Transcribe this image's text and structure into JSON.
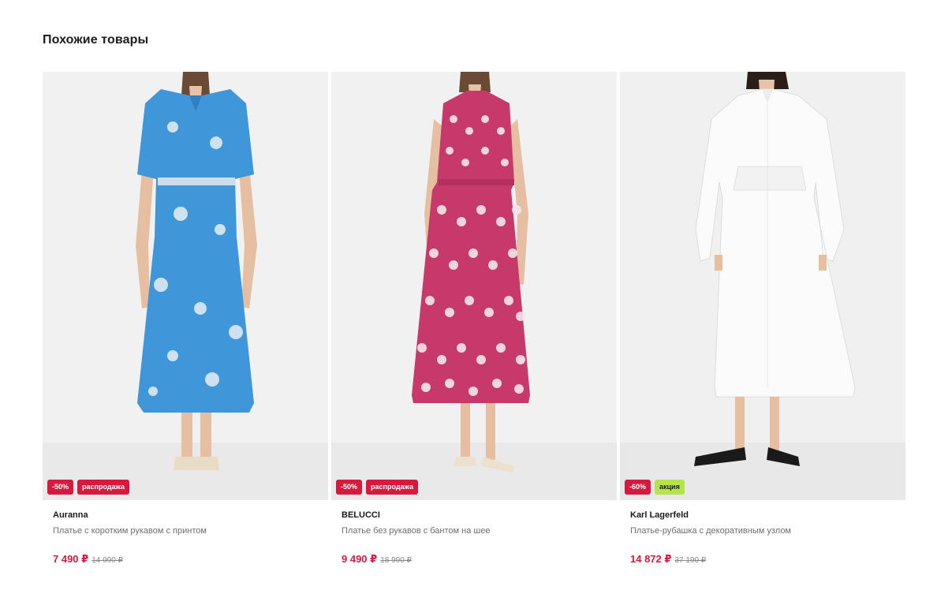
{
  "section": {
    "title": "Похожие товары"
  },
  "products": [
    {
      "brand": "Auranna",
      "name": "Платье с коротким рукавом с принтом",
      "price": "7 490 ₽",
      "old_price": "14 990 ₽",
      "badges": [
        "-50%",
        "распродажа"
      ],
      "badge_colors": [
        "#d7193f",
        "#d7193f"
      ],
      "dress_color": "#3f97d9"
    },
    {
      "brand": "BELUCCI",
      "name": "Платье без рукавов с бантом на шее",
      "price": "9 490 ₽",
      "old_price": "18 990 ₽",
      "badges": [
        "-50%",
        "распродажа"
      ],
      "badge_colors": [
        "#d7193f",
        "#d7193f"
      ],
      "dress_color": "#c7386b"
    },
    {
      "brand": "Karl Lagerfeld",
      "name": "Платье-рубашка с декоративным узлом",
      "price": "14 872 ₽",
      "old_price": "37 190 ₽",
      "badges": [
        "-60%",
        "акция"
      ],
      "badge_colors": [
        "#d7193f",
        "#b6e24a"
      ],
      "dress_color": "#fafafa"
    }
  ]
}
